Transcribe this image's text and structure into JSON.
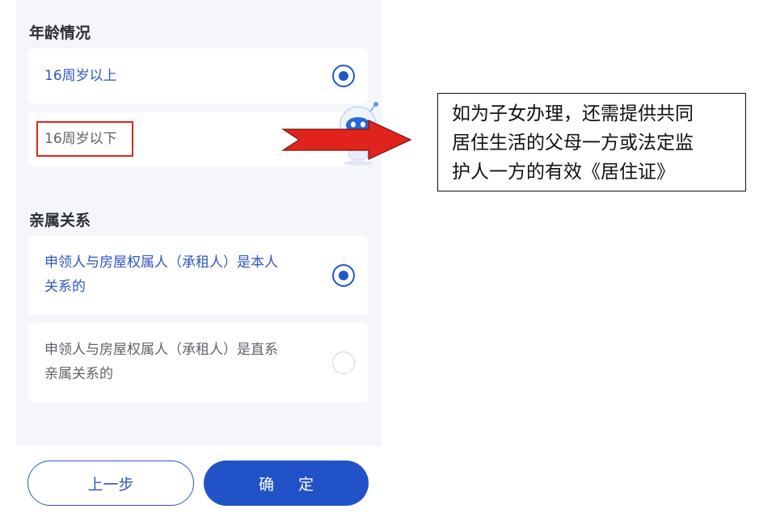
{
  "age_section": {
    "title": "年龄情况",
    "options": [
      {
        "label": "16周岁以上",
        "selected": true
      },
      {
        "label": "16周岁以下",
        "selected": false
      }
    ]
  },
  "relation_section": {
    "title": "亲属关系",
    "options": [
      {
        "line1": "申领人与房屋权属人（承租人）是本人",
        "line2": "关系的",
        "selected": true
      },
      {
        "line1": "申领人与房屋权属人（承租人）是直系",
        "line2": "亲属关系的",
        "selected": false
      }
    ]
  },
  "buttons": {
    "prev_label": "上一步",
    "confirm_label": "确 定"
  },
  "annotation": {
    "line1": "如为子女办理，还需提供共同",
    "line2": "居住生活的父母一方或法定监",
    "line3": "护人一方的有效《居住证》"
  },
  "colors": {
    "accent": "#2252c7",
    "highlight": "#e0241b",
    "arrow": "#e0241b",
    "page_bg": "#f4f6fa"
  },
  "icons": {
    "mascot": "robot-assistant-icon",
    "arrow": "right-arrow-icon"
  }
}
